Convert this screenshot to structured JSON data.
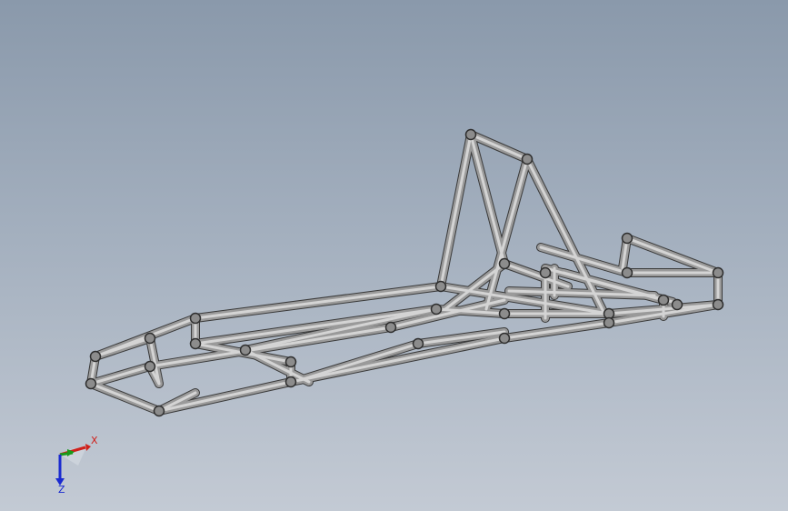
{
  "viewport": {
    "background_top": "#8a99ab",
    "background_bottom": "#c3cad4"
  },
  "model": {
    "name_icon": "tube-frame-chassis-model",
    "tube_color": "#9a9a9a",
    "tube_edge_color": "#3a3a3a"
  },
  "triad": {
    "x_label": "X",
    "z_label": "Z",
    "x_color": "#d0201a",
    "y_color": "#1a9a1a",
    "z_color": "#1a2ad0"
  }
}
